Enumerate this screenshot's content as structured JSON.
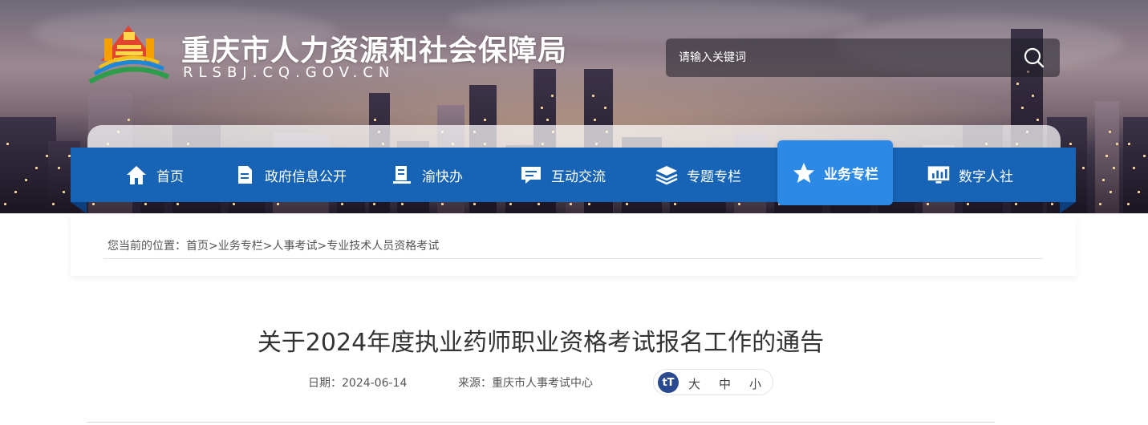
{
  "site": {
    "title": "重庆市人力资源和社会保障局",
    "domain": "RLSBJ.CQ.GOV.CN"
  },
  "search": {
    "placeholder": "请输入关键词",
    "icon": "search-icon"
  },
  "nav": {
    "items": [
      {
        "label": "首页",
        "icon": "home-icon",
        "active": false
      },
      {
        "label": "政府信息公开",
        "icon": "document-icon",
        "active": false
      },
      {
        "label": "渝快办",
        "icon": "book-icon",
        "active": false
      },
      {
        "label": "互动交流",
        "icon": "chat-icon",
        "active": false
      },
      {
        "label": "专题专栏",
        "icon": "layers-icon",
        "active": false
      },
      {
        "label": "业务专栏",
        "icon": "star-icon",
        "active": true
      },
      {
        "label": "数字人社",
        "icon": "monitor-icon",
        "active": false
      }
    ]
  },
  "breadcrumb": {
    "prefix": "您当前的位置：",
    "items": [
      "首页",
      "业务专栏",
      "人事考试",
      "专业技术人员资格考试"
    ],
    "separator": ">"
  },
  "article": {
    "title": "关于2024年度执业药师职业资格考试报名工作的通告",
    "date_label": "日期：",
    "date": "2024-06-14",
    "source_label": "来源：",
    "source": "重庆市人事考试中心"
  },
  "font_size": {
    "icon_label": "tT",
    "large": "大",
    "medium": "中",
    "small": "小"
  },
  "colors": {
    "nav_bg": "#1764b6",
    "nav_active": "#2c8ae6",
    "font_badge": "#2a4a8f"
  }
}
